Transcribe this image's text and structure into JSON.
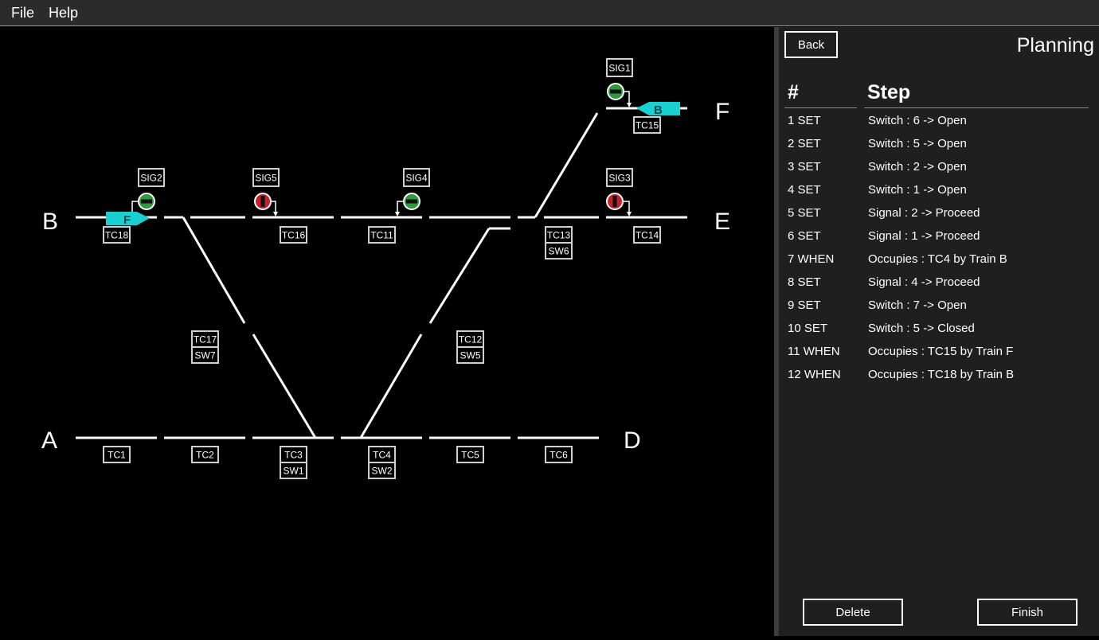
{
  "menu": {
    "file": "File",
    "help": "Help"
  },
  "panel": {
    "back": "Back",
    "title": "Planning",
    "col_num": "#",
    "col_step": "Step",
    "steps": [
      {
        "num": "1 SET",
        "step": "Switch : 6 -> Open"
      },
      {
        "num": "2 SET",
        "step": "Switch : 5 -> Open"
      },
      {
        "num": "3 SET",
        "step": "Switch : 2 -> Open"
      },
      {
        "num": "4 SET",
        "step": "Switch : 1 -> Open"
      },
      {
        "num": "5 SET",
        "step": "Signal : 2 -> Proceed"
      },
      {
        "num": "6 SET",
        "step": "Signal : 1 -> Proceed"
      },
      {
        "num": "7 WHEN",
        "step": "Occupies : TC4 by Train B"
      },
      {
        "num": "8 SET",
        "step": "Signal : 4 -> Proceed"
      },
      {
        "num": "9 SET",
        "step": "Switch : 7 -> Open"
      },
      {
        "num": "10 SET",
        "step": "Switch : 5 -> Closed"
      },
      {
        "num": "11 WHEN",
        "step": "Occupies : TC15 by Train F"
      },
      {
        "num": "12 WHEN",
        "step": "Occupies : TC18 by Train B"
      }
    ],
    "delete": "Delete",
    "finish": "Finish"
  },
  "track": {
    "endpoints": {
      "A": "A",
      "B": "B",
      "D": "D",
      "E": "E",
      "F": "F"
    },
    "circuits": {
      "tc1": "TC1",
      "tc2": "TC2",
      "tc3": "TC3",
      "tc4": "TC4",
      "tc5": "TC5",
      "tc6": "TC6",
      "tc11": "TC11",
      "tc12": "TC12",
      "tc13": "TC13",
      "tc14": "TC14",
      "tc15": "TC15",
      "tc16": "TC16",
      "tc17": "TC17",
      "tc18": "TC18"
    },
    "switches": {
      "sw1": "SW1",
      "sw2": "SW2",
      "sw5": "SW5",
      "sw6": "SW6",
      "sw7": "SW7"
    },
    "signals": {
      "sig1": {
        "label": "SIG1",
        "state": "proceed"
      },
      "sig2": {
        "label": "SIG2",
        "state": "proceed"
      },
      "sig3": {
        "label": "SIG3",
        "state": "stop"
      },
      "sig4": {
        "label": "SIG4",
        "state": "proceed"
      },
      "sig5": {
        "label": "SIG5",
        "state": "stop"
      }
    },
    "trains": {
      "train_f": "F",
      "train_b": "B"
    },
    "colors": {
      "proceed": "#2e9a3e",
      "stop": "#c8202a",
      "train": "#19d0d0",
      "rail": "#ffffff"
    }
  }
}
